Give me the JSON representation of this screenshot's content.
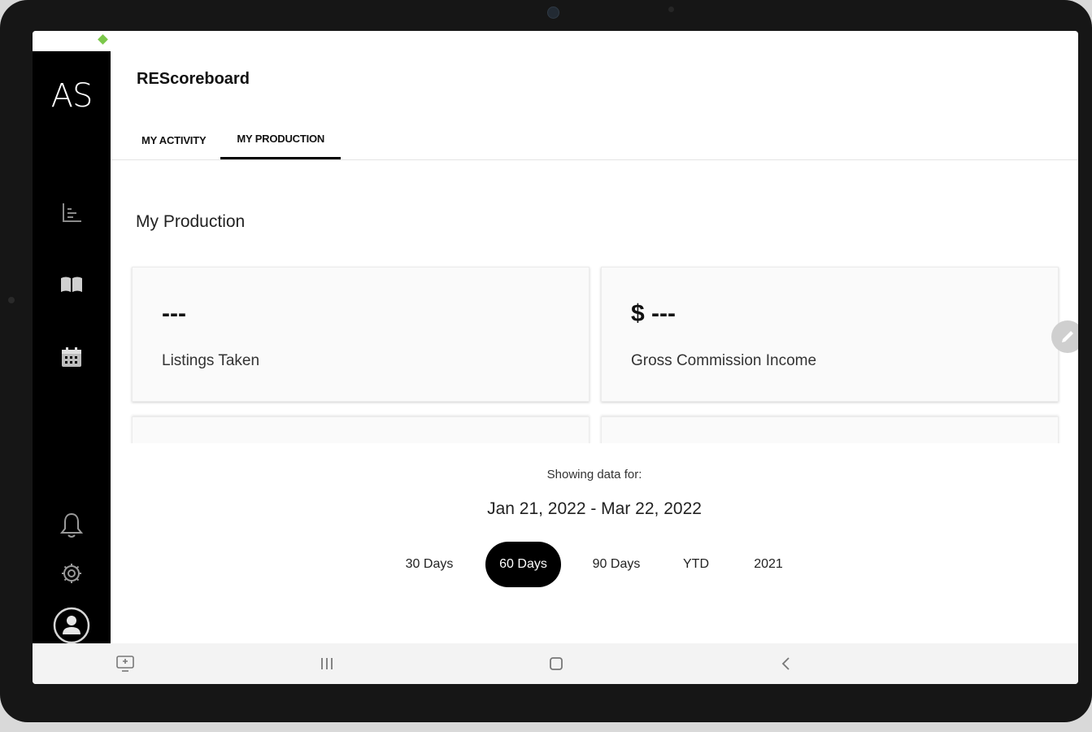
{
  "app": {
    "logo": "AS",
    "title": "REScoreboard"
  },
  "tabs": [
    {
      "label": "MY ACTIVITY",
      "active": false
    },
    {
      "label": "MY PRODUCTION",
      "active": true
    }
  ],
  "section_title": "My Production",
  "cards": [
    {
      "value": "---",
      "label": "Listings Taken"
    },
    {
      "value": "$ ---",
      "label": "Gross Commission Income"
    }
  ],
  "date_filter": {
    "showing_label": "Showing data for:",
    "range_text": "Jan 21, 2022 - Mar 22, 2022",
    "options": [
      "30 Days",
      "60 Days",
      "90 Days",
      "YTD",
      "2021"
    ],
    "selected": "60 Days"
  },
  "sidebar": {
    "top_icons": [
      "chart-icon",
      "book-icon",
      "calendar-icon"
    ],
    "bottom_icons": [
      "bell-icon",
      "gear-icon",
      "profile-icon"
    ]
  },
  "system_nav": [
    "recent-apps-icon",
    "home-icon",
    "back-icon",
    "assistant-icon"
  ],
  "colors": {
    "rail": "#000000",
    "active_pill": "#000000",
    "status_indicator": "#7bc84a"
  }
}
